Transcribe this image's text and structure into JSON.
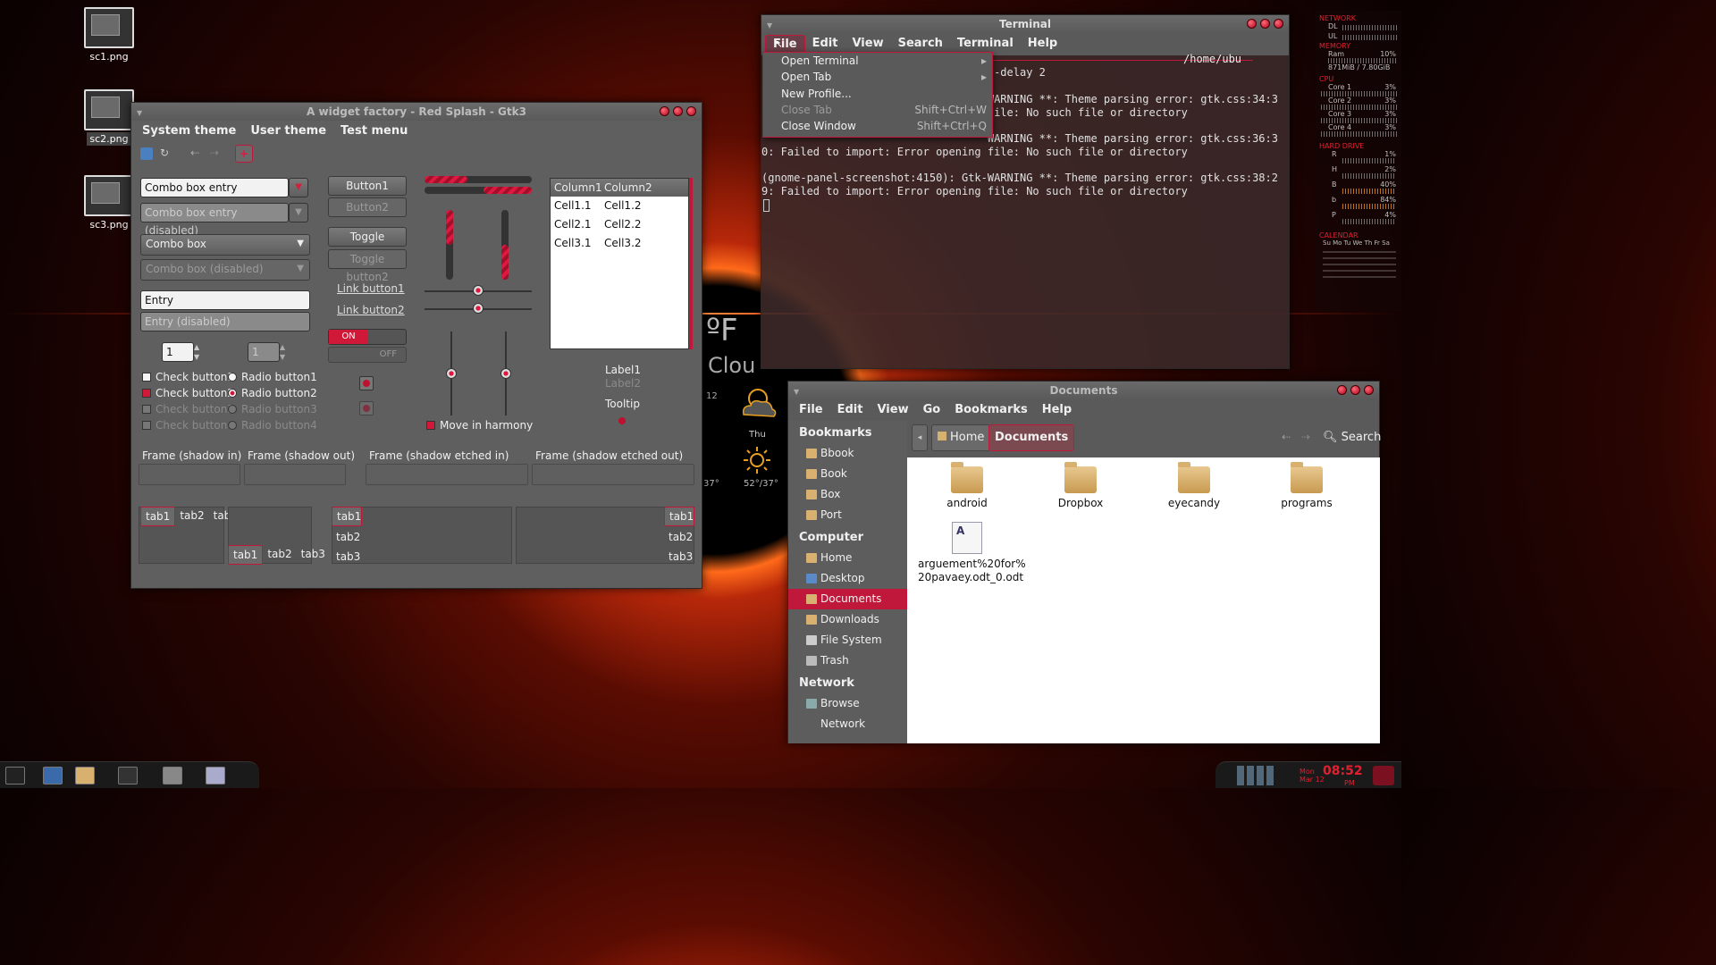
{
  "desktop_icons": [
    {
      "label": "sc1.png"
    },
    {
      "label": "sc2.png"
    },
    {
      "label": "sc3.png"
    }
  ],
  "weather": {
    "temp": "ºF",
    "cond": "Clou",
    "num": "12",
    "day": "Thu",
    "range1": "37°",
    "range2": "52°/37°"
  },
  "widget_factory": {
    "title": "A widget factory - Red Splash - Gtk3",
    "menu": [
      "System theme",
      "User theme",
      "Test menu"
    ],
    "combo_entry": "Combo box entry",
    "combo_entry_dis": "Combo box entry (disabled)",
    "combo": "Combo box",
    "combo_dis": "Combo box (disabled)",
    "entry": "Entry",
    "entry_dis": "Entry (disabled)",
    "spin1": "1",
    "spin2": "1",
    "checks": [
      "Check button1",
      "Check button2",
      "Check button3",
      "Check button4"
    ],
    "radios": [
      "Radio button1",
      "Radio button2",
      "Radio button3",
      "Radio button4"
    ],
    "button1": "Button1",
    "button2": "Button2",
    "toggle1": "Toggle button1",
    "toggle2": "Toggle button2",
    "link1": "Link button1",
    "link2": "Link button2",
    "switch_on": "ON",
    "switch_off": "OFF",
    "move_harmony": "Move in harmony",
    "columns": [
      "Column1",
      "Column2"
    ],
    "rows": [
      [
        "Cell1.1",
        "Cell1.2"
      ],
      [
        "Cell2.1",
        "Cell2.2"
      ],
      [
        "Cell3.1",
        "Cell3.2"
      ]
    ],
    "label1": "Label1",
    "label2": "Label2",
    "tooltip": "Tooltip",
    "frames": [
      "Frame (shadow in)",
      "Frame (shadow out)",
      "Frame (shadow etched in)",
      "Frame (shadow etched out)"
    ],
    "tabs": [
      "tab1",
      "tab2",
      "tab3"
    ],
    "progress_top": 0.4,
    "progress_bottom": 0.45,
    "vprog1": 0.5,
    "vprog2": 0.5,
    "hscale1": 0.5,
    "hscale2": 0.5,
    "vscale1": 0.5,
    "vscale2": 0.5
  },
  "terminal": {
    "title": "Terminal",
    "menu": [
      "File",
      "Edit",
      "View",
      "Search",
      "Terminal",
      "Help"
    ],
    "path": "/home/ubu",
    "lines": [
      "                                   --delay 2",
      "",
      "                                   WARNING **: Theme parsing error: gtk.css:34:3",
      "                                   file: No such file or directory",
      "",
      "                                   WARNING **: Theme parsing error: gtk.css:36:3",
      "0: Failed to import: Error opening file: No such file or directory",
      "",
      "(gnome-panel-screenshot:4150): Gtk-WARNING **: Theme parsing error: gtk.css:38:2",
      "9: Failed to import: Error opening file: No such file or directory"
    ],
    "file_menu": [
      {
        "label": "Open Terminal",
        "accel": "▸",
        "disabled": false
      },
      {
        "label": "Open Tab",
        "accel": "▸",
        "disabled": false
      },
      {
        "label": "New Profile...",
        "accel": "",
        "disabled": false
      },
      {
        "label": "Close Tab",
        "accel": "Shift+Ctrl+W",
        "disabled": true
      },
      {
        "label": "Close Window",
        "accel": "Shift+Ctrl+Q",
        "disabled": false
      }
    ]
  },
  "files": {
    "title": "Documents",
    "menu": [
      "File",
      "Edit",
      "View",
      "Go",
      "Bookmarks",
      "Help"
    ],
    "path": [
      "Home",
      "Documents"
    ],
    "search": "Search",
    "sections": [
      {
        "head": "Bookmarks",
        "items": [
          "Bbook",
          "Book",
          "Box",
          "Port"
        ]
      },
      {
        "head": "Computer",
        "items": [
          "Home",
          "Desktop",
          "Documents",
          "Downloads",
          "File System",
          "Trash"
        ]
      },
      {
        "head": "Network",
        "items": [
          "Browse Network"
        ]
      }
    ],
    "items": [
      {
        "name": "android"
      },
      {
        "name": "Dropbox"
      },
      {
        "name": "eyecandy"
      },
      {
        "name": "programs"
      },
      {
        "name": "arguement%20for%\n20pavaey.odt_0.odt"
      }
    ]
  },
  "conky": {
    "network": "NETWORK",
    "dl": "DL",
    "ul": "UL",
    "memory": "MEMORY",
    "ram": "Ram",
    "ram_pct": "10%",
    "ram_val": "871MiB / 7.80GiB",
    "cpu": "CPU",
    "cores": [
      "Core 1",
      "Core 2",
      "Core 3",
      "Core 4"
    ],
    "cpu_pct": [
      "3%",
      "3%",
      "3%",
      "3%"
    ],
    "hdd": "HARD DRIVE",
    "hdd_rows": [
      "R",
      "H",
      "B",
      "b",
      "P"
    ],
    "hdd_pct": [
      "1%",
      "2%",
      "40%",
      "84%",
      "4%"
    ],
    "calendar": "CALENDAR",
    "cal_days": "Su Mo Tu We Th Fr Sa"
  },
  "clock": {
    "time": "08:52",
    "day": "Mon",
    "date": "Mar 12",
    "ampm": "PM"
  }
}
